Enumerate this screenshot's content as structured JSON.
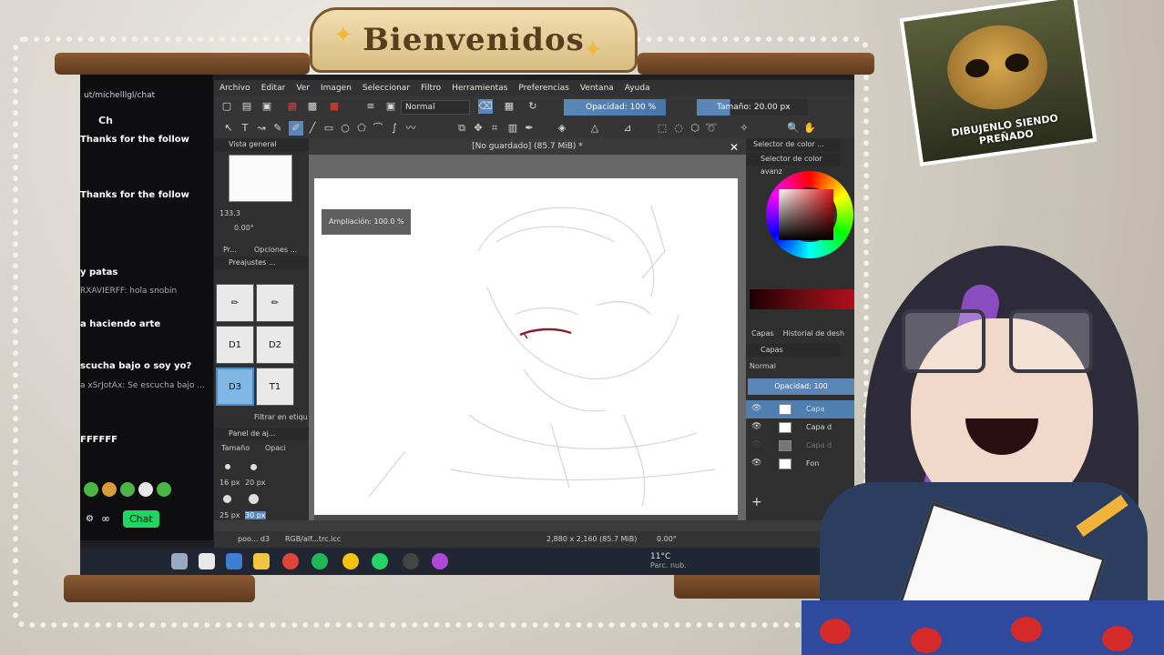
{
  "overlay": {
    "banner_text": "Bienvenidos",
    "meme_caption": "DIBUJENLO SIENDO PREÑADO"
  },
  "chat": {
    "url": "ut/michelllgl/chat",
    "title": "Ch",
    "messages": [
      {
        "text": "Thanks for the follow",
        "style": "bold"
      },
      {
        "text": "Thanks for the follow",
        "style": "bold"
      },
      {
        "text": "y patas",
        "style": "bold"
      },
      {
        "text": "RXAVIERFF: hola snobin",
        "style": "dim"
      },
      {
        "text": "a haciendo arte",
        "style": "bold"
      },
      {
        "text": "scucha bajo o soy yo?",
        "style": "bold"
      },
      {
        "text": "a xSrJotAx: Se escucha bajo ...",
        "style": "dim"
      },
      {
        "text": "FFFFFF",
        "style": "bold"
      }
    ],
    "chat_button": "Chat"
  },
  "krita": {
    "menu": [
      "Archivo",
      "Editar",
      "Ver",
      "Imagen",
      "Seleccionar",
      "Filtro",
      "Herramientas",
      "Preferencias",
      "Ventana",
      "Ayuda"
    ],
    "blend_mode": "Normal",
    "opacity_label": "Opacidad: 100 %",
    "size_label": "Tamaño: 20.00 px",
    "canvas_title": "[No guardado] (85.7 MiB) *",
    "zoom_toast": "Ampliación: 100.0 %",
    "left_dock": {
      "overview_title": "Vista general",
      "zoom_value": "133.3",
      "rotation_value": "0.00°",
      "tab_pr": "Pr...",
      "tab_options": "Opciones ...",
      "presets_title": "Preajustes ...",
      "presets": [
        "D1",
        "D2",
        "D3",
        "T1"
      ],
      "filter_label": "Filtrar en etiqu",
      "panel_title": "Panel de aj...",
      "size_tab": "Tamaño",
      "opacity_tab": "Opaci",
      "brush_sizes": [
        "16 px",
        "20 px",
        "25 px",
        "30 px"
      ]
    },
    "right_dock": {
      "selector_title": "Selector de color ...",
      "advanced_selector": "Selector de color avanz",
      "layers_tab": "Capas",
      "history_tab": "Historial de desh",
      "layers_title": "Capas",
      "layer_blend": "Normal",
      "layer_opacity": "Opacidad: 100",
      "layers": [
        {
          "name": "Capa",
          "selected": true
        },
        {
          "name": "Capa d",
          "selected": false
        },
        {
          "name": "Capa d",
          "selected": false
        },
        {
          "name": "Fon",
          "selected": false
        }
      ]
    },
    "status": {
      "brush": "poo... d3",
      "color_profile": "RGB/alf...trc.icc",
      "dimensions": "2,880 x 2,160 (85.7 MiB)",
      "rotation": "0.00°"
    }
  },
  "taskbar": {
    "weather_temp": "11°C",
    "weather_desc": "Parc. nub."
  },
  "colors": {
    "krita_bg": "#3b3b3b",
    "accent_blue": "#5b87b7",
    "chat_green": "#1ed760",
    "stroke_red": "#8b1e2b"
  }
}
